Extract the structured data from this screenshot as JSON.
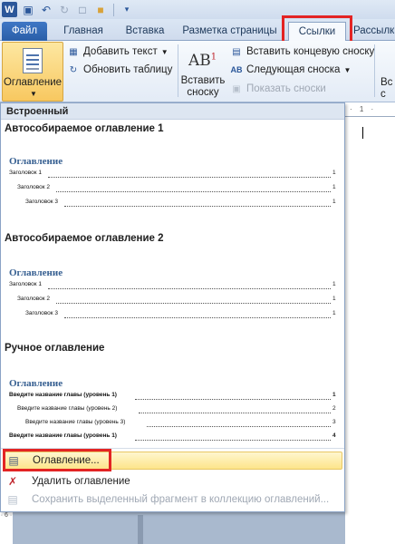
{
  "qat": {
    "icons": [
      "word-icon",
      "save-icon",
      "undo-icon",
      "redo-icon",
      "new-icon",
      "open-icon",
      "customize-icon"
    ]
  },
  "tabs": [
    "Файл",
    "Главная",
    "Вставка",
    "Разметка страницы",
    "Ссылки",
    "Рассылки"
  ],
  "ribbon": {
    "toc_button": "Оглавление",
    "add_text": "Добавить текст",
    "update_table": "Обновить таблицу",
    "ab_icon": "AB",
    "ab_sup": "1",
    "insert_footnote": "Вставить сноску",
    "insert_endnote": "Вставить концевую сноску",
    "next_footnote": "Следующая сноска",
    "show_notes": "Показать сноски",
    "right_partial": "Вс с"
  },
  "dropdown": {
    "header": "Встроенный",
    "auto1": {
      "title": "Автособираемое оглавление 1",
      "heading": "Оглавление",
      "lines": [
        {
          "text": "Заголовок 1",
          "num": "1"
        },
        {
          "text": "Заголовок 2",
          "num": "1"
        },
        {
          "text": "Заголовок 3",
          "num": "1"
        }
      ]
    },
    "auto2": {
      "title": "Автособираемое оглавление 2",
      "heading": "Оглавление",
      "lines": [
        {
          "text": "Заголовок 1",
          "num": "1"
        },
        {
          "text": "Заголовок 2",
          "num": "1"
        },
        {
          "text": "Заголовок 3",
          "num": "1"
        }
      ]
    },
    "manual": {
      "title": "Ручное оглавление",
      "heading": "Оглавление",
      "lines": [
        {
          "text": "Введите название главы (уровень 1)",
          "num": "1"
        },
        {
          "text": "Введите название главы (уровень 2)",
          "num": "2"
        },
        {
          "text": "Введите название главы (уровень 3)",
          "num": "3"
        },
        {
          "text": "Введите название главы (уровень 1)",
          "num": "4"
        }
      ]
    },
    "menu": {
      "toc": "Оглавление...",
      "remove": "Удалить оглавление",
      "save_selection": "Сохранить выделенный фрагмент в коллекцию оглавлений..."
    }
  },
  "ruler_text": "· 1 ·",
  "vruler_text": "· 6 ·",
  "colors": {
    "file_tab": "#2a5ea8",
    "highlight": "#fde58a",
    "callout_red": "#e32424",
    "toc_heading": "#365f91"
  }
}
